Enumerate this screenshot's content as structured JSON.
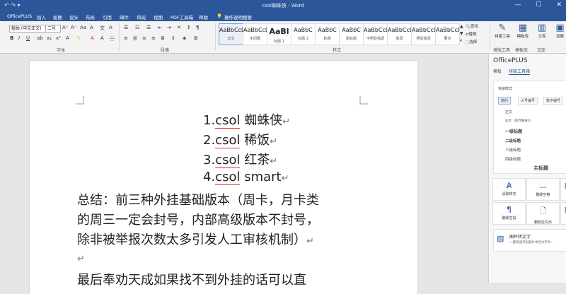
{
  "titlebar": {
    "title": "csol蜘蛛侠 - Word",
    "qat": "↶ ↷ ▾"
  },
  "menu": [
    "OfficePLUS",
    "插入",
    "绘图",
    "设计",
    "布局",
    "引用",
    "邮件",
    "审阅",
    "视图",
    "PDF工具箱",
    "帮助"
  ],
  "menu_search": "操作说明搜索",
  "ribbon": {
    "font_name": "楷体 (中文正文)",
    "font_size": "二号",
    "group_font": "字体",
    "group_paragraph": "段落",
    "group_styles": "样式",
    "styles": [
      {
        "sample": "AaBbCcDd",
        "name": "正文"
      },
      {
        "sample": "AaBbCcDd",
        "name": "无间隔"
      },
      {
        "sample": "AaBl",
        "name": "标题 1"
      },
      {
        "sample": "AaBbC",
        "name": "标题 2"
      },
      {
        "sample": "AaBbC",
        "name": "标题"
      },
      {
        "sample": "AaBbC",
        "name": "副标题"
      },
      {
        "sample": "AaBbCcDd",
        "name": "不明显强调"
      },
      {
        "sample": "AaBbCcDd",
        "name": "强调"
      },
      {
        "sample": "AaBbCcDd",
        "name": "明显强调"
      },
      {
        "sample": "AaBbCcDd",
        "name": "要点"
      }
    ],
    "right_small": [
      "查找",
      "替换",
      "选择"
    ],
    "right_buttons": [
      "排版工具",
      "模板库",
      "文库"
    ],
    "right_group_labels": [
      "排版工具",
      "模板库",
      "文库"
    ],
    "add_in": "加载"
  },
  "document": {
    "list": [
      {
        "num": "1.",
        "term": "csol",
        "rest": " 蜘蛛侠"
      },
      {
        "num": "2.",
        "term": "csol",
        "rest": " 稀饭"
      },
      {
        "num": "3.",
        "term": "csol",
        "rest": " 红茶"
      },
      {
        "num": "4.",
        "term": "csol",
        "rest": " smart"
      }
    ],
    "para_lines": [
      "总结：前三种外挂基础版本（周卡，月卡类",
      "的周三一定会封号，内部高级版本不封号，",
      "除非被举报次数太多引发人工审核机制）"
    ],
    "last_line": "最后奉劝天成如果找不到外挂的话可以直",
    "pilcrow": "↵"
  },
  "pane": {
    "title": "OfficePLUS",
    "tabs": [
      "模板",
      "排版工具箱"
    ],
    "quick_style_label": "快速样式",
    "chips": [
      "简约",
      "大号编号",
      "数字编号"
    ],
    "style_list": [
      "正文",
      "正文（首行缩进2）",
      "一级标题",
      "二级标题",
      "三级标题",
      "四级标题",
      "主标题"
    ],
    "tools": [
      "清除样式",
      "删除空格",
      "删除空段",
      "删除空白页"
    ],
    "img2text_title": "图片转文字",
    "img2text_desc": "一键快速识别图片中的文字并..."
  }
}
